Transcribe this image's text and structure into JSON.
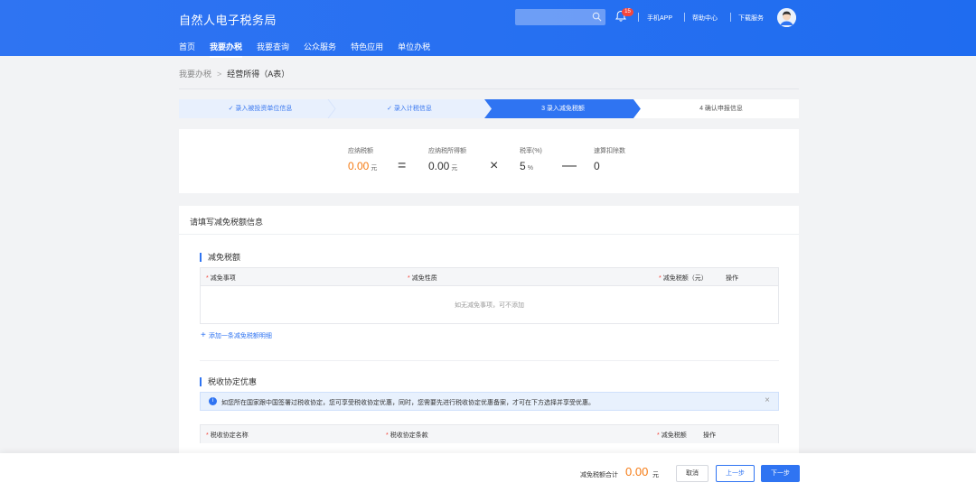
{
  "header": {
    "brand": "自然人电子税务局",
    "notification_count": "15",
    "links": [
      "手机APP",
      "帮助中心",
      "下载服务"
    ],
    "nav": [
      "首页",
      "我要办税",
      "我要查询",
      "公众服务",
      "特色应用",
      "单位办税"
    ],
    "active_nav": "我要办税"
  },
  "breadcrumb": {
    "parent": "我要办税",
    "current": "经营所得（A表）"
  },
  "steps": [
    {
      "label": "录入被投资单位信息",
      "state": "done"
    },
    {
      "label": "录入计税信息",
      "state": "done"
    },
    {
      "label": "3 录入减免税额",
      "state": "active"
    },
    {
      "label": "4 确认申报信息",
      "state": "todo"
    }
  ],
  "formula": {
    "tax_payable_label": "应纳税额",
    "tax_payable_value": "0.00",
    "taxable_income_label": "应纳税所得额",
    "taxable_income_value": "0.00",
    "rate_label": "税率(%)",
    "rate_value": "5",
    "rate_unit": "%",
    "deduction_label": "速算扣除数",
    "deduction_value": "0",
    "unit": "元",
    "eq": "=",
    "times": "×",
    "minus": "—"
  },
  "form": {
    "title": "请填写减免税额信息",
    "section1": {
      "title": "减免税额",
      "columns": [
        "减免事项",
        "减免性质",
        "减免税额（元）",
        "操作"
      ],
      "empty_text": "如无减免事项，可不添加",
      "add_link": "添加一条减免税额明细"
    },
    "section2": {
      "title": "税收协定优惠",
      "notice": "如您所在国家跟中国签署过税收协定，您可享受税收协定优惠，同时，您需要先进行税收协定优惠备案，才可在下方选择并享受优惠。",
      "columns": [
        "税收协定名称",
        "税收协定条款",
        "减免税额",
        "操作"
      ]
    }
  },
  "footer": {
    "total_label": "减免税额合计",
    "total_value": "0.00",
    "total_unit": "元",
    "cancel": "取消",
    "prev": "上一步",
    "next": "下一步"
  },
  "colors": {
    "primary": "#2f74f2",
    "accent_orange": "#f57b14",
    "required_red": "#f5463c"
  }
}
